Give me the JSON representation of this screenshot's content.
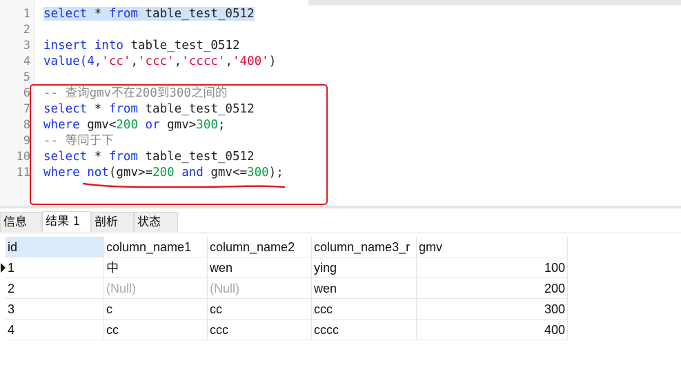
{
  "editor": {
    "lines": [
      {
        "n": "1",
        "tokens": [
          {
            "t": "select",
            "c": "kw sel"
          },
          {
            "t": " * ",
            "c": "id sel"
          },
          {
            "t": "from",
            "c": "kw sel"
          },
          {
            "t": " table_test_0512",
            "c": "id sel"
          }
        ]
      },
      {
        "n": "2",
        "tokens": []
      },
      {
        "n": "3",
        "tokens": [
          {
            "t": "insert",
            "c": "kw"
          },
          {
            "t": " ",
            "c": "id"
          },
          {
            "t": "into",
            "c": "kw"
          },
          {
            "t": " table_test_0512",
            "c": "id"
          }
        ]
      },
      {
        "n": "4",
        "tokens": [
          {
            "t": "value(4,",
            "c": "kw"
          },
          {
            "t": "'cc'",
            "c": "str"
          },
          {
            "t": ",",
            "c": "id"
          },
          {
            "t": "'ccc'",
            "c": "str"
          },
          {
            "t": ",",
            "c": "id"
          },
          {
            "t": "'cccc'",
            "c": "str"
          },
          {
            "t": ",",
            "c": "id"
          },
          {
            "t": "'400'",
            "c": "str"
          },
          {
            "t": ")",
            "c": "id"
          }
        ]
      },
      {
        "n": "5",
        "tokens": []
      },
      {
        "n": "6",
        "tokens": [
          {
            "t": "-- 查询gmv不在200到300之间的",
            "c": "cm"
          }
        ]
      },
      {
        "n": "7",
        "tokens": [
          {
            "t": "select",
            "c": "kw"
          },
          {
            "t": " * ",
            "c": "id"
          },
          {
            "t": "from",
            "c": "kw"
          },
          {
            "t": " table_test_0512",
            "c": "id"
          }
        ]
      },
      {
        "n": "8",
        "tokens": [
          {
            "t": "where",
            "c": "kw"
          },
          {
            "t": " gmv<",
            "c": "id"
          },
          {
            "t": "200",
            "c": "num"
          },
          {
            "t": " ",
            "c": "id"
          },
          {
            "t": "or",
            "c": "kw"
          },
          {
            "t": " gmv>",
            "c": "id"
          },
          {
            "t": "300",
            "c": "num"
          },
          {
            "t": ";",
            "c": "id"
          }
        ]
      },
      {
        "n": "9",
        "tokens": [
          {
            "t": "-- 等同于下",
            "c": "cm"
          }
        ]
      },
      {
        "n": "10",
        "tokens": [
          {
            "t": "select",
            "c": "kw"
          },
          {
            "t": " * ",
            "c": "id"
          },
          {
            "t": "from",
            "c": "kw"
          },
          {
            "t": " table_test_0512",
            "c": "id"
          }
        ]
      },
      {
        "n": "11",
        "tokens": [
          {
            "t": "where",
            "c": "kw"
          },
          {
            "t": " ",
            "c": "id"
          },
          {
            "t": "not",
            "c": "kw"
          },
          {
            "t": "(gmv>=",
            "c": "id"
          },
          {
            "t": "200",
            "c": "num"
          },
          {
            "t": " ",
            "c": "id"
          },
          {
            "t": "and",
            "c": "kw"
          },
          {
            "t": " gmv<=",
            "c": "id"
          },
          {
            "t": "300",
            "c": "num"
          },
          {
            "t": ");",
            "c": "id"
          }
        ]
      }
    ]
  },
  "tabs": [
    {
      "label": "信息",
      "active": false
    },
    {
      "label": "结果 1",
      "active": true
    },
    {
      "label": "剖析",
      "active": false
    },
    {
      "label": "状态",
      "active": false
    }
  ],
  "grid": {
    "columns": [
      "id",
      "column_name1",
      "column_name2",
      "column_name3_r",
      "gmv"
    ],
    "rows": [
      [
        "1",
        "中",
        "wen",
        "ying",
        "100"
      ],
      [
        "2",
        "(Null)",
        "(Null)",
        "wen",
        "200"
      ],
      [
        "3",
        "c",
        "cc",
        "ccc",
        "300"
      ],
      [
        "4",
        "cc",
        "ccc",
        "cccc",
        "400"
      ]
    ],
    "current_row": 0
  },
  "colors": {
    "keyword": "#1a34e8",
    "string": "#e0103d",
    "number": "#0aa34a",
    "comment": "#8c8c8c",
    "annotation": "#e01b24"
  }
}
